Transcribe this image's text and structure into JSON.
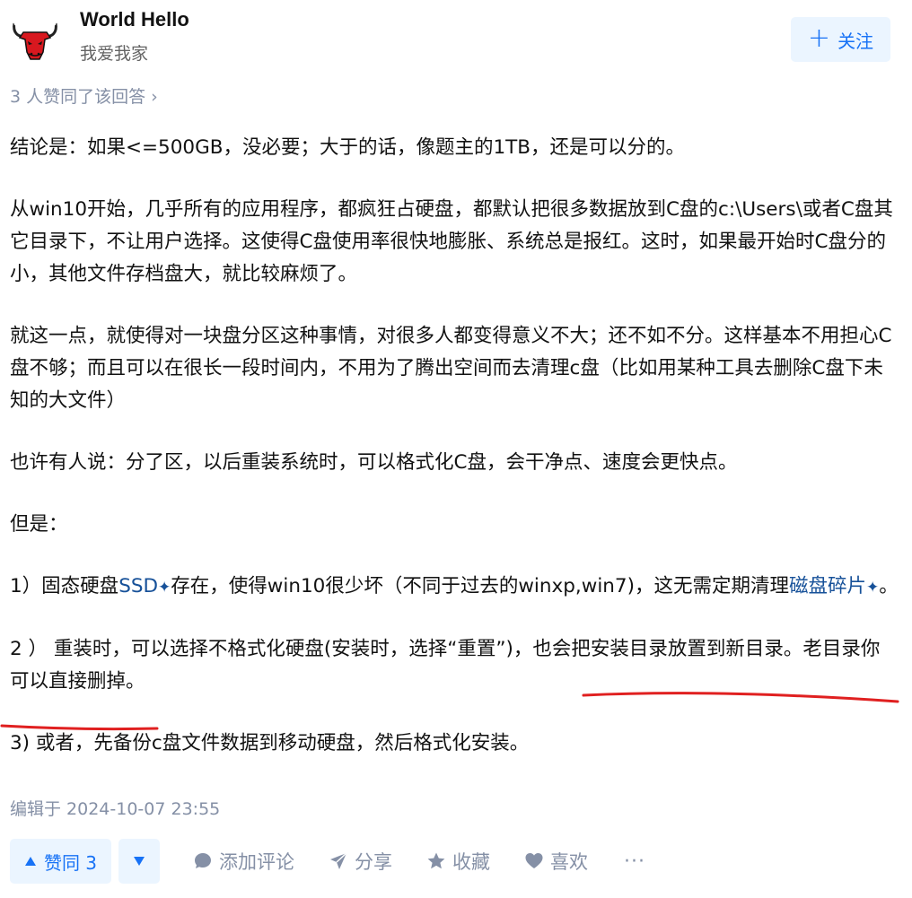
{
  "author": {
    "name": "World Hello",
    "bio": "我爱我家",
    "avatar_icon": "bull-head-icon"
  },
  "follow_button": {
    "label": "关注",
    "icon": "plus-icon"
  },
  "upvoters_text": "3 人赞同了该回答",
  "content": {
    "p1": "结论是：如果<=500GB，没必要；大于的话，像题主的1TB，还是可以分的。",
    "p2": "从win10开始，几乎所有的应用程序，都疯狂占硬盘，都默认把很多数据放到C盘的c:\\Users\\或者C盘其它目录下，不让用户选择。这使得C盘使用率很快地膨胀、系统总是报红。这时，如果最开始时C盘分的小，其他文件存档盘大，就比较麻烦了。",
    "p3": "就这一点，就使得对一块盘分区这种事情，对很多人都变得意义不大；还不如不分。这样基本不用担心C盘不够；而且可以在很长一段时间内，不用为了腾出空间而去清理c盘（比如用某种工具去删除C盘下未知的大文件）",
    "p4": "也许有人说：分了区，以后重装系统时，可以格式化C盘，会干净点、速度会更快点。",
    "p5": "但是：",
    "p6_a": "1）固态硬盘",
    "p6_link1": "SSD",
    "p6_b": "存在，使得win10很少坏（不同于过去的winxp,win7)，这无需定期清理",
    "p6_link2": "磁盘碎片",
    "p6_c": "。",
    "p7": "2 ） 重装时，可以选择不格式化硬盘(安装时，选择“重置”)，也会把安装目录放置到新目录。老目录你可以直接删掉。",
    "p8": "3) 或者，先备份c盘文件数据到移动硬盘，然后格式化安装。"
  },
  "edited_text": "编辑于 2024-10-07 23:55",
  "actions": {
    "upvote_label": "赞同 3",
    "comment_label": "添加评论",
    "share_label": "分享",
    "collect_label": "收藏",
    "like_label": "喜欢",
    "more_label": "···"
  },
  "colors": {
    "accent": "#1772f6",
    "accent_bg": "#ebf5ff",
    "link": "#175199",
    "muted": "#8590a6",
    "annotation_red": "#e02020"
  }
}
